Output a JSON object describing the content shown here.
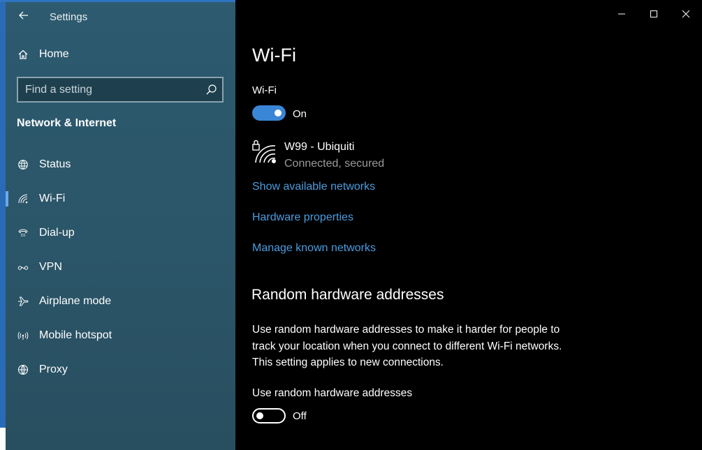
{
  "window": {
    "title": "Settings"
  },
  "sidebar": {
    "home_label": "Home",
    "search": {
      "placeholder": "Find a setting"
    },
    "section_title": "Network & Internet",
    "items": [
      {
        "label": "Status",
        "icon": "globe-status-icon",
        "active": false
      },
      {
        "label": "Wi-Fi",
        "icon": "wifi-icon",
        "active": true
      },
      {
        "label": "Dial-up",
        "icon": "dial-up-icon",
        "active": false
      },
      {
        "label": "VPN",
        "icon": "vpn-icon",
        "active": false
      },
      {
        "label": "Airplane mode",
        "icon": "airplane-icon",
        "active": false
      },
      {
        "label": "Mobile hotspot",
        "icon": "hotspot-icon",
        "active": false
      },
      {
        "label": "Proxy",
        "icon": "globe-icon",
        "active": false
      }
    ]
  },
  "main": {
    "page_title": "Wi-Fi",
    "wifi_toggle": {
      "label": "Wi-Fi",
      "state_text": "On",
      "on": true
    },
    "network": {
      "name": "W99 - Ubiquiti",
      "status": "Connected, secured",
      "icon": "secured-wifi-icon"
    },
    "links": [
      "Show available networks",
      "Hardware properties",
      "Manage known networks"
    ],
    "random_hw": {
      "heading": "Random hardware addresses",
      "description": "Use random hardware addresses to make it harder for people to track your location when you connect to different Wi-Fi networks. This setting applies to new connections.",
      "toggle_label": "Use random hardware addresses",
      "state_text": "Off",
      "on": false
    }
  },
  "colors": {
    "sidebar_bg": "#2b5568",
    "main_bg": "#000000",
    "accent": "#3a86d6",
    "link": "#4a9de0",
    "secondary_text": "#9a9a9a"
  }
}
